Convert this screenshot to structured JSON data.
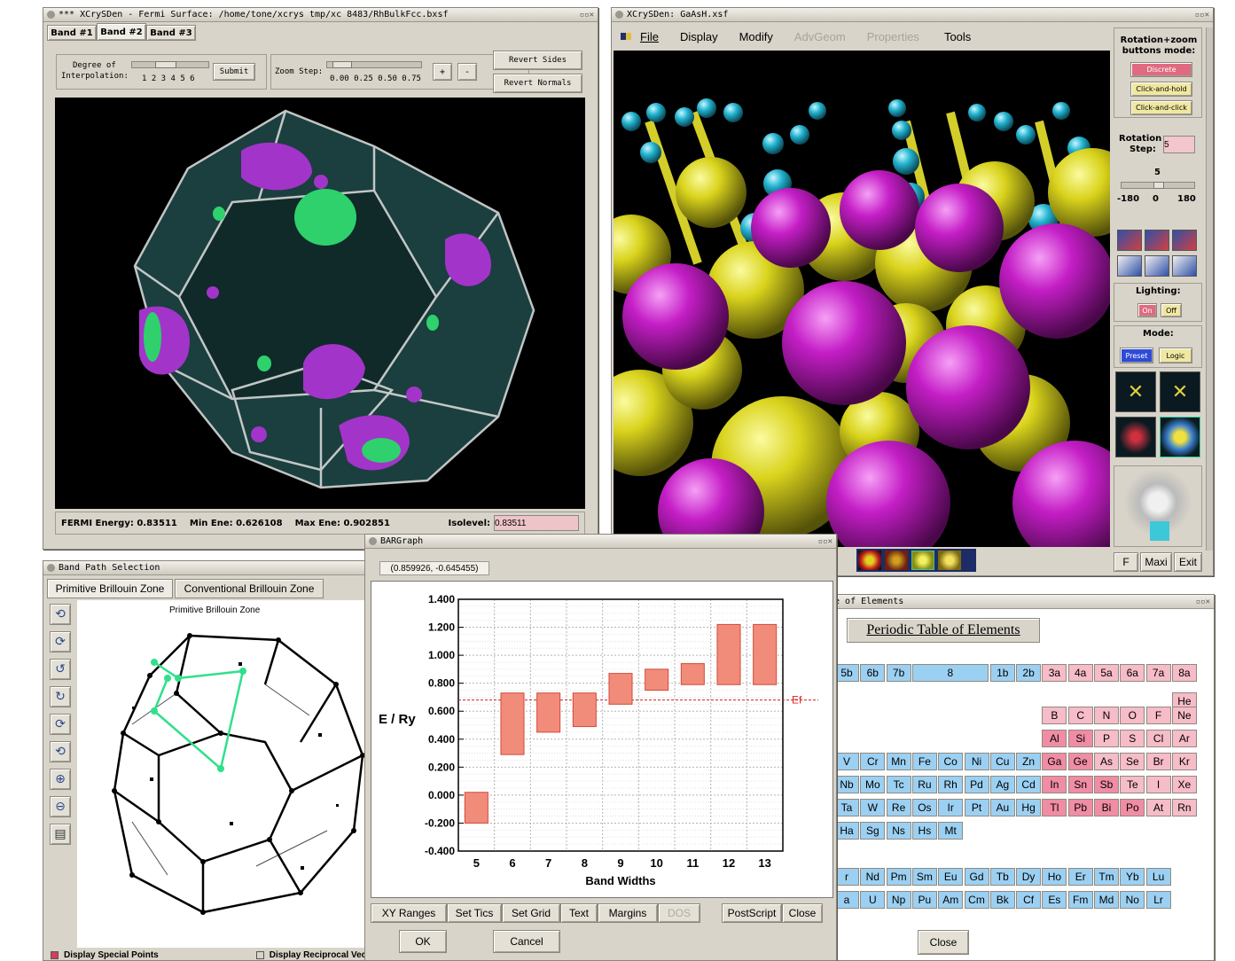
{
  "fermi": {
    "title": "*** XCrySDen - Fermi Surface: /home/tone/xcrys tmp/xc 8483/RhBulkFcc.bxsf",
    "tabs": [
      "Band #1",
      "Band #2",
      "Band #3"
    ],
    "interp_label_1": "Degree of",
    "interp_label_2": "Interpolation:",
    "interp_ticks": "1 2 3 4 5 6",
    "submit": "Submit",
    "zoom_label": "Zoom Step:",
    "zoom_ticks": "0.00 0.25 0.50 0.75",
    "plus": "+",
    "minus": "-",
    "revert_sides": "Revert Sides",
    "revert_normals": "Revert Normals",
    "fermi_energy": "FERMI Energy: 0.83511",
    "min_ene": "Min Ene: 0.626108",
    "max_ene": "Max Ene: 0.902851",
    "isolevel_label": "Isolevel:",
    "isolevel_value": "0.83511"
  },
  "gaas": {
    "title": "XCrySDen: GaAsH.xsf",
    "menu": [
      "File",
      "Display",
      "Modify",
      "AdvGeom",
      "Properties",
      "Tools"
    ],
    "rot_mode_label": "Rotation+zoom buttons mode:",
    "btn_discrete": "Discrete",
    "btn_click_hold": "Click-and-hold",
    "btn_click_click": "Click-and-click",
    "rot_step_label_1": "Rotation",
    "rot_step_label_2": "Step:",
    "rot_step_value": "5",
    "scale_min": "-180",
    "scale_mid": "0",
    "scale_max": "180",
    "lighting_label": "Lighting:",
    "on": "On",
    "off": "Off",
    "mode_label": "Mode:",
    "preset": "Preset",
    "logic": "Logic",
    "f": "F",
    "maxi": "Maxi",
    "exit": "Exit"
  },
  "bandpath": {
    "title": "Band Path Selection",
    "tab_primitive": "Primitive Brillouin Zone",
    "tab_conventional": "Conventional Brillouin Zone",
    "canvas_title": "Primitive Brillouin Zone",
    "display_special": "Display Special Points",
    "display_reciprocal": "Display Reciprocal Vectors",
    "ok": "OK",
    "cancel": "Cancel"
  },
  "periodic": {
    "title": "le of Elements",
    "heading": "Periodic Table of Elements",
    "close": "Close",
    "groups": [
      "5b",
      "6b",
      "7b",
      "8",
      "1b",
      "2b",
      "3a",
      "4a",
      "5a",
      "6a",
      "7a",
      "8a"
    ],
    "row1": [
      "He"
    ],
    "row2": [
      "B",
      "C",
      "N",
      "O",
      "F",
      "Ne"
    ],
    "row3": [
      "Al",
      "Si",
      "P",
      "S",
      "Cl",
      "Ar"
    ],
    "row4": [
      "V",
      "Cr",
      "Mn",
      "Fe",
      "Co",
      "Ni",
      "Cu",
      "Zn",
      "Ga",
      "Ge",
      "As",
      "Se",
      "Br",
      "Kr"
    ],
    "row5": [
      "Nb",
      "Mo",
      "Tc",
      "Ru",
      "Rh",
      "Pd",
      "Ag",
      "Cd",
      "In",
      "Sn",
      "Sb",
      "Te",
      "I",
      "Xe"
    ],
    "row6": [
      "Ta",
      "W",
      "Re",
      "Os",
      "Ir",
      "Pt",
      "Au",
      "Hg",
      "Tl",
      "Pb",
      "Bi",
      "Po",
      "At",
      "Rn"
    ],
    "row7": [
      "Ha",
      "Sg",
      "Ns",
      "Hs",
      "Mt"
    ],
    "lan": [
      "r",
      "Nd",
      "Pm",
      "Sm",
      "Eu",
      "Gd",
      "Tb",
      "Dy",
      "Ho",
      "Er",
      "Tm",
      "Yb",
      "Lu"
    ],
    "act": [
      "a",
      "U",
      "Np",
      "Pu",
      "Am",
      "Cm",
      "Bk",
      "Cf",
      "Es",
      "Fm",
      "Md",
      "No",
      "Lr"
    ]
  },
  "bargraph": {
    "title": "BARGraph",
    "coords": "(0.859926, -0.645455)",
    "buttons": [
      "XY Ranges",
      "Set Tics",
      "Set Grid",
      "Text",
      "Margins",
      "DOS",
      "PostScript",
      "Close"
    ]
  },
  "chart_data": {
    "type": "bar",
    "title": "",
    "xlabel": "Band Widths",
    "ylabel": "E / Ry",
    "categories": [
      "5",
      "6",
      "7",
      "8",
      "9",
      "10",
      "11",
      "12",
      "13"
    ],
    "ranges": [
      [
        -0.2,
        0.02
      ],
      [
        0.29,
        0.73
      ],
      [
        0.45,
        0.73
      ],
      [
        0.49,
        0.73
      ],
      [
        0.65,
        0.87
      ],
      [
        0.75,
        0.9
      ],
      [
        0.79,
        0.94
      ],
      [
        0.79,
        1.22
      ],
      [
        0.79,
        1.22
      ]
    ],
    "ylim": [
      -0.4,
      1.4
    ],
    "yticks": [
      "1.400",
      "1.200",
      "1.000",
      "0.800",
      "0.600",
      "0.400",
      "0.200",
      "0.000",
      "-0.200",
      "-0.400"
    ],
    "fermi_level": 0.68,
    "fermi_label": "Ef",
    "grid": true,
    "bar_color": "#f28c7a"
  }
}
